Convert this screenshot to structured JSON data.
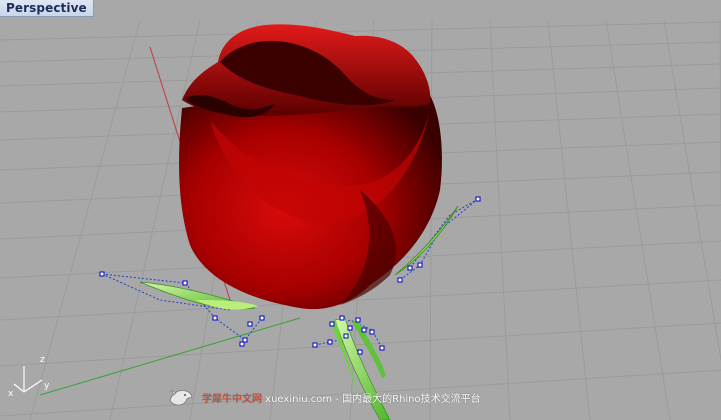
{
  "viewport": {
    "title": "Perspective"
  },
  "watermark": {
    "brand": "学犀牛中文网",
    "text": " xuexiniu.com  - 国内最大的Rhino技术交流平台"
  },
  "colors": {
    "background": "#a8a8a8",
    "grid": "#999999",
    "x_axis": "#c23a3a",
    "y_axis": "#3aa13a",
    "petal": "#b30000",
    "leaf": "#7fd94a",
    "control_point": "#0000c8"
  },
  "icons": {
    "axis_indicator": "xyz-axis-icon",
    "watermark_logo": "rhino-logo-icon"
  }
}
